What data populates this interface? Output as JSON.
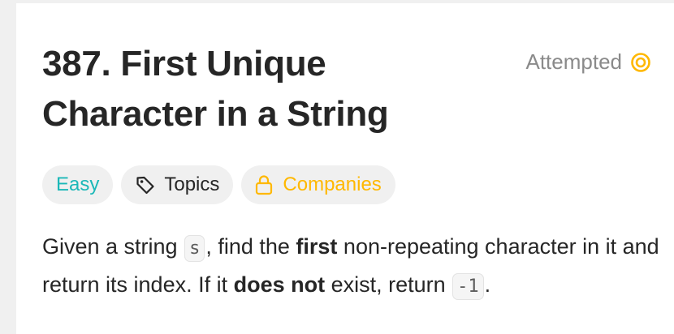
{
  "problem": {
    "title": "387. First Unique Character in a String",
    "status": "Attempted"
  },
  "tags": {
    "difficulty": "Easy",
    "topics": "Topics",
    "companies": "Companies"
  },
  "description": {
    "part1": "Given a string ",
    "code_s": "s",
    "part2": ", find the ",
    "bold_first": "first",
    "part3": " non-repeating character in it and return its index. If it ",
    "bold_not": "does not",
    "part4": " exist, return ",
    "code_neg1": "-1",
    "part5": "."
  },
  "colors": {
    "easy": "#1cb8b8",
    "companies_locked": "#ffb800",
    "attempted_icon": "#ffb800"
  },
  "icons": {
    "status": "attempted-target-icon",
    "topics": "tag-icon",
    "companies": "lock-icon"
  }
}
